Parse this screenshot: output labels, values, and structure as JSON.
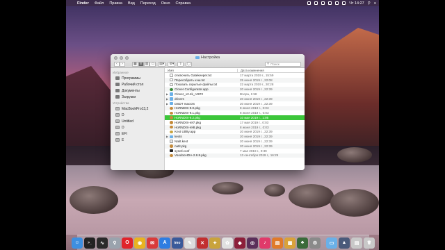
{
  "menubar": {
    "app_name": "Finder",
    "items": [
      "Файл",
      "Правка",
      "Вид",
      "Переход",
      "Окно",
      "Справка"
    ],
    "clock": "Чт 14:27"
  },
  "window": {
    "title": "Настройка",
    "search_placeholder": "Поиск"
  },
  "sidebar": {
    "favorites_header": "Избранное",
    "favorites": [
      "Программы",
      "Рабочий стол",
      "Документы",
      "Загрузки"
    ],
    "devices_header": "Устройства",
    "devices": [
      "MacBookPro13,2",
      "D",
      "Untitled",
      "D",
      "EFI",
      "E"
    ]
  },
  "filelist": {
    "col_name": "Имя",
    "col_date": "Дата изменения",
    "rows": [
      {
        "name": "отключить Gatekeeper.txt",
        "date": "17 марта 2019 г., 15:59",
        "icon": "txt",
        "folder": false
      },
      {
        "name": "Пересобрать кэш.txt",
        "date": "25 июня 2019 г., 22:08",
        "icon": "txt",
        "folder": false
      },
      {
        "name": "Показать скрытые файлы.txt",
        "date": "22 марта 2019 г., 20:28",
        "icon": "txt",
        "folder": false
      },
      {
        "name": "Clover Configurator.app",
        "date": "20 июня 2019 г., 22:39",
        "icon": "clover",
        "folder": false
      },
      {
        "name": "Clover_v2.4k_r4972",
        "date": "Вчера, 1:58",
        "icon": "folder",
        "folder": true
      },
      {
        "name": "drivers",
        "date": "20 июня 2019 г., 22:39",
        "icon": "folder",
        "folder": true
      },
      {
        "name": "DSDT macOS",
        "date": "20 июня 2019 г., 22:39",
        "icon": "folder",
        "folder": true
      },
      {
        "name": "HoRNDIS-9.0.pkg",
        "date": "8 июня 2019 г., 0:03",
        "icon": "pkg",
        "folder": false
      },
      {
        "name": "HoRNDIS-9.1.pkg",
        "date": "8 июня 2019 г., 0:03",
        "icon": "pkg",
        "folder": false
      },
      {
        "name": "HoRNDIS-9.2.pkg",
        "date": "10 мая 2019 г., 1:05",
        "icon": "pkg",
        "folder": false,
        "selected": true
      },
      {
        "name": "HoRNDIS-rel7.pkg",
        "date": "17 мая 2019 г., 0:03",
        "icon": "pkg",
        "folder": false
      },
      {
        "name": "HoRNDIS-rel8.pkg",
        "date": "8 июня 2019 г., 0:03",
        "icon": "pkg",
        "folder": false
      },
      {
        "name": "Kext Utility.app",
        "date": "20 июня 2019 г., 22:39",
        "icon": "app",
        "folder": false
      },
      {
        "name": "kexts",
        "date": "20 июня 2019 г., 22:39",
        "icon": "folder",
        "folder": true
      },
      {
        "name": "Natit.kext",
        "date": "20 июня 2019 г., 22:39",
        "icon": "doc",
        "folder": false
      },
      {
        "name": "natit.pkg",
        "date": "20 июня 2019 г., 22:39",
        "icon": "pkg",
        "folder": false
      },
      {
        "name": "sysctl.conf",
        "date": "7 мая 2019 г., 0:39",
        "icon": "term",
        "folder": false
      },
      {
        "name": "VoodooHDA-2.8.8.pkg",
        "date": "13 сентября 2019 г., 16:29",
        "icon": "pkg",
        "folder": false
      }
    ]
  },
  "dock": {
    "apps": [
      {
        "name": "finder-icon",
        "color": "#3d8fe0",
        "glyph": "☺"
      },
      {
        "name": "terminal-icon",
        "color": "#222222",
        "glyph": ">_"
      },
      {
        "name": "activity-monitor-icon",
        "color": "#2a2a2a",
        "glyph": "∿"
      },
      {
        "name": "launchpad-icon",
        "color": "#9aa3ad",
        "glyph": "⚲"
      },
      {
        "name": "opera-icon",
        "color": "#e0242b",
        "glyph": "O"
      },
      {
        "name": "chrome-icon",
        "color": "#e8b321",
        "glyph": "◉"
      },
      {
        "name": "mail-icon",
        "color": "#d93b3b",
        "glyph": "✉"
      },
      {
        "name": "app-store-icon",
        "color": "#2f7de1",
        "glyph": "A"
      },
      {
        "name": "imo-icon",
        "color": "#3a5a9a",
        "glyph": "imo"
      },
      {
        "name": "preview-icon",
        "color": "#dcdcdc",
        "glyph": "✎"
      },
      {
        "name": "photo-booth-icon",
        "color": "#c22f2f",
        "glyph": "✕"
      },
      {
        "name": "utility-icon",
        "color": "#c9a33c",
        "glyph": "✦"
      },
      {
        "name": "photos-icon",
        "color": "#e0e0e0",
        "glyph": "✿"
      },
      {
        "name": "graphics-icon",
        "color": "#8c1f3a",
        "glyph": "◆"
      },
      {
        "name": "network-icon",
        "color": "#5a2f5a",
        "glyph": "◎"
      },
      {
        "name": "music-icon",
        "color": "#e03a6a",
        "glyph": "♪"
      },
      {
        "name": "books-icon",
        "color": "#e07a2a",
        "glyph": "▤"
      },
      {
        "name": "archive-icon",
        "color": "#d9a23a",
        "glyph": "▦"
      },
      {
        "name": "clover-config-icon",
        "color": "#3a6a3a",
        "glyph": "♣"
      },
      {
        "name": "system-preferences-icon",
        "color": "#8a8a8a",
        "glyph": "⚙"
      }
    ],
    "right": [
      {
        "name": "folder-stack-icon",
        "color": "#6ab0e8",
        "glyph": "▭"
      },
      {
        "name": "downloads-stack-icon",
        "color": "#4a5a7a",
        "glyph": "▲"
      },
      {
        "name": "documents-stack-icon",
        "color": "#c8c8c8",
        "glyph": "▤"
      },
      {
        "name": "trash-icon",
        "color": "#c8c8c8",
        "glyph": "🗑"
      }
    ]
  }
}
